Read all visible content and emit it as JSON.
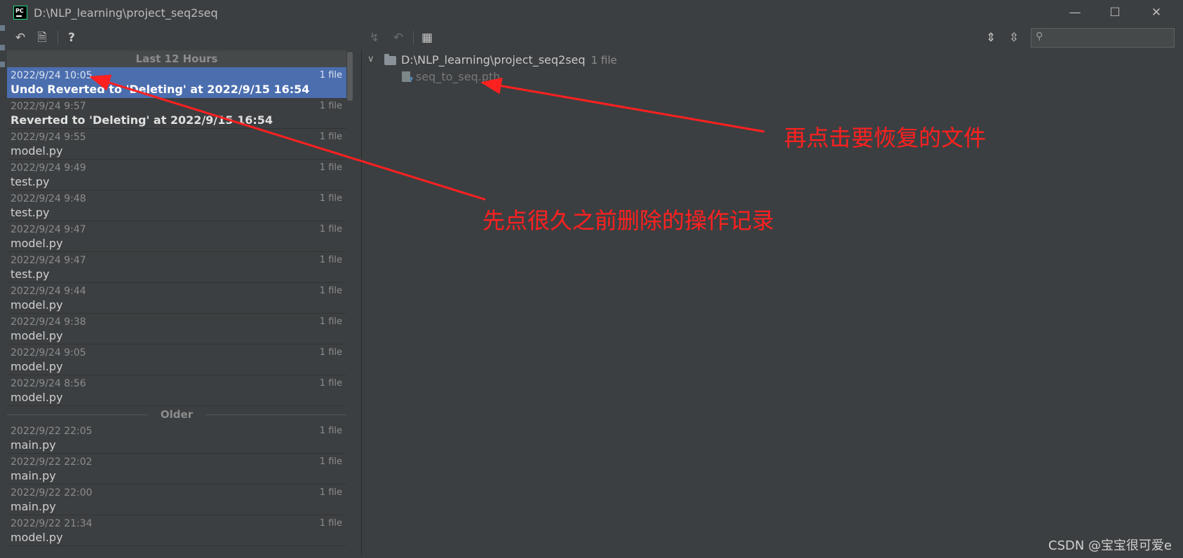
{
  "window": {
    "title": "D:\\NLP_learning\\project_seq2seq",
    "app_icon_text": "PC",
    "minimize_glyph": "—",
    "maximize_glyph": "☐",
    "close_glyph": "✕"
  },
  "toolbar": {
    "undo_icon": "↶",
    "patch_icon": "🗎",
    "help_label": "?",
    "revert_icon": "↯",
    "undo2_icon": "↶",
    "group_icon": "▦",
    "expand_all_icon": "⇕",
    "collapse_all_icon": "⇳",
    "search_placeholder": ""
  },
  "history": {
    "groups": [
      {
        "title": "Last 12 Hours",
        "items": [
          {
            "date": "2022/9/24 10:05",
            "count": "1 file",
            "label": "Undo Reverted to 'Deleting' at 2022/9/15 16:54",
            "bold": true,
            "selected": true
          },
          {
            "date": "2022/9/24 9:57",
            "count": "1 file",
            "label": "Reverted to 'Deleting' at 2022/9/15 16:54",
            "bold": true
          },
          {
            "date": "2022/9/24 9:55",
            "count": "1 file",
            "label": "model.py"
          },
          {
            "date": "2022/9/24 9:49",
            "count": "1 file",
            "label": "test.py"
          },
          {
            "date": "2022/9/24 9:48",
            "count": "1 file",
            "label": "test.py"
          },
          {
            "date": "2022/9/24 9:47",
            "count": "1 file",
            "label": "model.py"
          },
          {
            "date": "2022/9/24 9:47",
            "count": "1 file",
            "label": "test.py"
          },
          {
            "date": "2022/9/24 9:44",
            "count": "1 file",
            "label": "model.py"
          },
          {
            "date": "2022/9/24 9:38",
            "count": "1 file",
            "label": "model.py"
          },
          {
            "date": "2022/9/24 9:05",
            "count": "1 file",
            "label": "model.py"
          },
          {
            "date": "2022/9/24 8:56",
            "count": "1 file",
            "label": "model.py"
          }
        ]
      },
      {
        "title": "Older",
        "items": [
          {
            "date": "2022/9/22 22:05",
            "count": "1 file",
            "label": "main.py"
          },
          {
            "date": "2022/9/22 22:02",
            "count": "1 file",
            "label": "main.py"
          },
          {
            "date": "2022/9/22 22:00",
            "count": "1 file",
            "label": "main.py"
          },
          {
            "date": "2022/9/22 21:34",
            "count": "1 file",
            "label": "model.py"
          }
        ]
      }
    ]
  },
  "tree": {
    "chevron": "∨",
    "root_path": "D:\\NLP_learning\\project_seq2seq",
    "root_count": "1 file",
    "file_name": "seq_to_seq.pth",
    "file_badge": "?"
  },
  "annotations": {
    "first_step": "先点很久之前删除的操作记录",
    "second_step": "再点击要恢复的文件",
    "color": "#ff2020"
  },
  "watermark": "CSDN @宝宝很可爱e"
}
